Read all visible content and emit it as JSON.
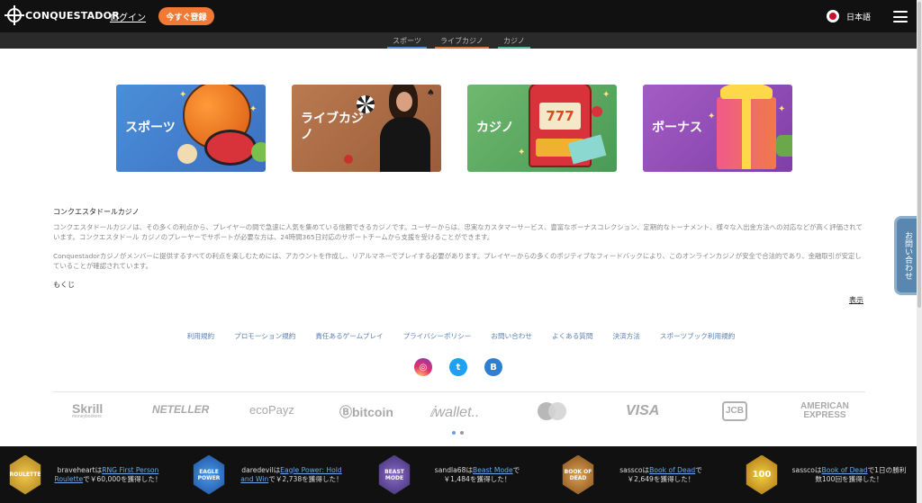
{
  "header": {
    "logo_text": "CONQUESTADOR",
    "login_label": "ログイン",
    "register_label": "今すぐ登録",
    "language_label": "日本語"
  },
  "subnav": {
    "items": [
      {
        "label": "スポーツ",
        "color": "#4a8fd8"
      },
      {
        "label": "ライブカジノ",
        "color": "#e0703a"
      },
      {
        "label": "カジノ",
        "color": "#4ab89a"
      }
    ]
  },
  "categories": [
    {
      "label": "スポーツ"
    },
    {
      "label": "ライブカジ\nノ"
    },
    {
      "label": "カジノ"
    },
    {
      "label": "ボーナス"
    }
  ],
  "content": {
    "title": "コンクエスタドールカジノ",
    "paragraph1": "コンクエスタドールカジノは、その多くの利点から、プレイヤーの間で急速に人気を集めている信頼できるカジノです。ユーザーからは、忠実なカスタマーサービス、豊富なボーナスコレクション、定期的なトーナメント、様々な入出金方法への対応などが高く評価されています。コンクエスタドール カジノのプレーヤーでサポートが必要な方は、24時間365日対応のサポートチームから支援を受けることができます。",
    "paragraph2": "Conquestadorカジノがメンバーに提供するすべての利点を楽しむためには、アカウントを作成し、リアルマネーでプレイする必要があります。プレイヤーからの多くのポジティブなフィードバックにより、このオンラインカジノが安全で合法的であり、金融取引が安定していることが確認されています。",
    "toc_label": "もくじ",
    "show_label": "表示"
  },
  "side_tab": {
    "label": "お問い合わせ"
  },
  "footer_links": [
    "利用規約",
    "プロモーション規約",
    "責任あるゲームプレイ",
    "プライバシーポリシー",
    "お問い合わせ",
    "よくある質問",
    "決済方法",
    "スポーツブック利用規約"
  ],
  "social": [
    {
      "name": "instagram",
      "glyph": "◎",
      "color": "#c13584"
    },
    {
      "name": "twitter",
      "glyph": "t",
      "color": "#1da1f2"
    },
    {
      "name": "blog",
      "glyph": "B",
      "color": "#2d7fd3"
    }
  ],
  "payments": [
    {
      "label": "Skrill",
      "sub": "moneybookers"
    },
    {
      "label": "NETELLER",
      "sub": ""
    },
    {
      "label": "ecoPayz",
      "sub": ""
    },
    {
      "label": "Ⓑbitcoin",
      "sub": ""
    },
    {
      "label": "ⅈwallet..",
      "sub": ""
    },
    {
      "label": "",
      "sub": ""
    },
    {
      "label": "VISA",
      "sub": ""
    },
    {
      "label": "JCB",
      "sub": ""
    },
    {
      "label": "AMERICAN\nEXPRESS",
      "sub": ""
    }
  ],
  "carousel_dots": [
    {
      "active": true,
      "color": "#6a9fe0"
    },
    {
      "active": false,
      "color": "#9a9a9a"
    }
  ],
  "winners": [
    {
      "badge": "ROULETTE",
      "badge_color": "#c8a030",
      "pre": "braveheartは",
      "game": "RNG First Person Roulette",
      "post": "で￥60,000を獲得した！"
    },
    {
      "badge": "EAGLE POWER",
      "badge_color": "#2a6fc8",
      "pre": "daredevilは",
      "game": "Eagle Power: Hold and Win",
      "post": "で￥2,738を獲得した！"
    },
    {
      "badge": "BEAST MODE",
      "badge_color": "#5a3a8a",
      "pre": "sandla68は",
      "game": "Beast Mode",
      "post": "で￥1,484を獲得した！"
    },
    {
      "badge": "BOOK OF DEAD",
      "badge_color": "#b8722a",
      "pre": "sasscoは",
      "game": "Book of Dead",
      "post": "で￥2,649を獲得した！"
    },
    {
      "badge": "100",
      "badge_color": "#d8a020",
      "pre": "sasscoは",
      "game": "Book of Dead",
      "post": "で1日の勝利数100回を獲得した！"
    }
  ]
}
